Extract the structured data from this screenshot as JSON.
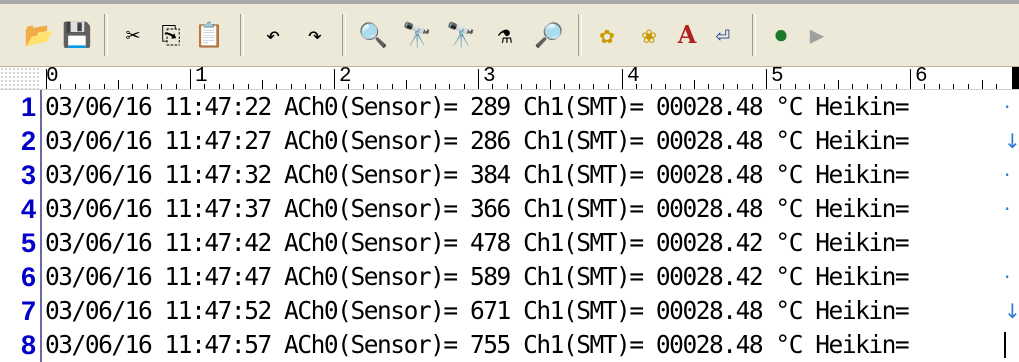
{
  "toolbar": {
    "buttons": [
      {
        "name": "open-file-icon",
        "glyph": "📂"
      },
      {
        "name": "save-file-icon",
        "glyph": "💾"
      },
      {
        "name": "cut-icon",
        "glyph": "✂"
      },
      {
        "name": "copy-icon",
        "glyph": "⎘"
      },
      {
        "name": "paste-icon",
        "glyph": "📋"
      },
      {
        "name": "undo-icon",
        "glyph": "↶"
      },
      {
        "name": "redo-icon",
        "glyph": "↷"
      },
      {
        "name": "find-icon",
        "glyph": "🔍"
      },
      {
        "name": "find-next-icon",
        "glyph": "🔭"
      },
      {
        "name": "find-prev-icon",
        "glyph": "🔭"
      },
      {
        "name": "replace-icon",
        "glyph": "⚗"
      },
      {
        "name": "grep-icon",
        "glyph": "🔎"
      },
      {
        "name": "settings-icon",
        "glyph": "✿"
      },
      {
        "name": "common-settings-icon",
        "glyph": "❀"
      },
      {
        "name": "font-icon",
        "glyph": "A"
      },
      {
        "name": "wrap-icon",
        "glyph": "⏎"
      },
      {
        "name": "macro-record-icon",
        "glyph": "⏺"
      },
      {
        "name": "macro-run-icon",
        "glyph": "▶"
      }
    ]
  },
  "ruler": {
    "labels": [
      "0",
      "1",
      "2",
      "3",
      "4",
      "5",
      "6"
    ]
  },
  "lines": [
    {
      "num": "1",
      "text": "03/06/16 11:47:22 ACh0(Sensor)= 289 Ch1(SMT)= 00028.48 °C Heikin=",
      "eol": "·"
    },
    {
      "num": "2",
      "text": "03/06/16 11:47:27 ACh0(Sensor)= 286 Ch1(SMT)= 00028.48 °C Heikin=",
      "eol": "↓"
    },
    {
      "num": "3",
      "text": "03/06/16 11:47:32 ACh0(Sensor)= 384 Ch1(SMT)= 00028.48 °C Heikin=",
      "eol": "·"
    },
    {
      "num": "4",
      "text": "03/06/16 11:47:37 ACh0(Sensor)= 366 Ch1(SMT)= 00028.48 °C Heikin=",
      "eol": "·"
    },
    {
      "num": "5",
      "text": "03/06/16 11:47:42 ACh0(Sensor)= 478 Ch1(SMT)= 00028.42 °C Heikin=",
      "eol": ""
    },
    {
      "num": "6",
      "text": "03/06/16 11:47:47 ACh0(Sensor)= 589 Ch1(SMT)= 00028.42 °C Heikin=",
      "eol": "·"
    },
    {
      "num": "7",
      "text": "03/06/16 11:47:52 ACh0(Sensor)= 671 Ch1(SMT)= 00028.48 °C Heikin=",
      "eol": "↓"
    },
    {
      "num": "8",
      "text": "03/06/16 11:47:57 ACh0(Sensor)= 755 Ch1(SMT)= 00028.48 °C Heikin=",
      "eol": ""
    }
  ]
}
